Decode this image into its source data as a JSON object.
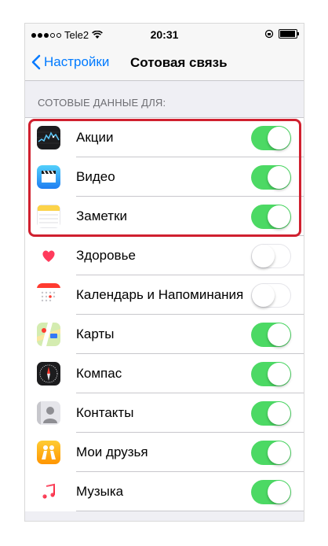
{
  "status": {
    "carrier": "Tele2",
    "time": "20:31",
    "battery_level": 1.0
  },
  "nav": {
    "back_label": "Настройки",
    "title": "Сотовая связь"
  },
  "section": {
    "header": "СОТОВЫЕ ДАННЫЕ ДЛЯ:"
  },
  "apps": [
    {
      "label": "Акции",
      "icon": "stocks-icon",
      "enabled": true
    },
    {
      "label": "Видео",
      "icon": "videos-icon",
      "enabled": true
    },
    {
      "label": "Заметки",
      "icon": "notes-icon",
      "enabled": true
    },
    {
      "label": "Здоровье",
      "icon": "health-icon",
      "enabled": false
    },
    {
      "label": "Календарь и Напоминания",
      "icon": "calendar-icon",
      "enabled": false
    },
    {
      "label": "Карты",
      "icon": "maps-icon",
      "enabled": true
    },
    {
      "label": "Компас",
      "icon": "compass-icon",
      "enabled": true
    },
    {
      "label": "Контакты",
      "icon": "contacts-icon",
      "enabled": true
    },
    {
      "label": "Мои друзья",
      "icon": "find-friends-icon",
      "enabled": true
    },
    {
      "label": "Музыка",
      "icon": "music-icon",
      "enabled": true
    }
  ],
  "colors": {
    "accent": "#007aff",
    "toggle_on": "#4cd964",
    "highlight": "#d0202f"
  }
}
